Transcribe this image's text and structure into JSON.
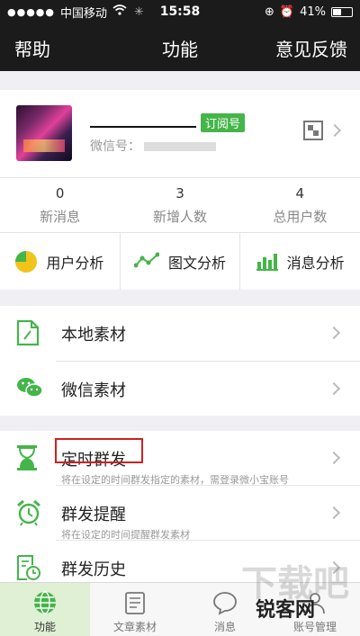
{
  "status_bar": {
    "signal": "●●●●●",
    "carrier": "中国移动",
    "time": "15:58",
    "battery": "41%"
  },
  "nav": {
    "left": "帮助",
    "title": "功能",
    "right": "意见反馈"
  },
  "account": {
    "badge": "订阅号",
    "wechat_id_label": "微信号："
  },
  "stats": [
    {
      "value": "0",
      "label": "新消息"
    },
    {
      "value": "3",
      "label": "新增人数"
    },
    {
      "value": "4",
      "label": "总用户数"
    }
  ],
  "analysis": [
    {
      "label": "用户分析",
      "icon": "pie-chart-icon"
    },
    {
      "label": "图文分析",
      "icon": "line-chart-icon"
    },
    {
      "label": "消息分析",
      "icon": "bar-chart-icon"
    }
  ],
  "materials": [
    {
      "label": "本地素材",
      "icon": "document-icon"
    },
    {
      "label": "微信素材",
      "icon": "wechat-icon"
    }
  ],
  "features": [
    {
      "label": "定时群发",
      "desc": "将在设定的时间群发指定的素材，需登录微小宝账号",
      "icon": "hourglass-icon"
    },
    {
      "label": "群发提醒",
      "desc": "将在设定的时间提醒群发素材",
      "icon": "alarm-clock-icon"
    },
    {
      "label": "群发历史",
      "icon": "history-icon"
    }
  ],
  "tabs": [
    {
      "label": "功能",
      "icon": "globe-icon",
      "active": true
    },
    {
      "label": "文章素材",
      "icon": "article-icon"
    },
    {
      "label": "消息",
      "icon": "chat-bubble-icon"
    },
    {
      "label": "账号管理",
      "icon": "account-icon"
    }
  ],
  "watermark": {
    "brand": "锐客网"
  },
  "colors": {
    "accent": "#44b549",
    "highlight": "#d02020",
    "header": "#1b1b1b"
  }
}
